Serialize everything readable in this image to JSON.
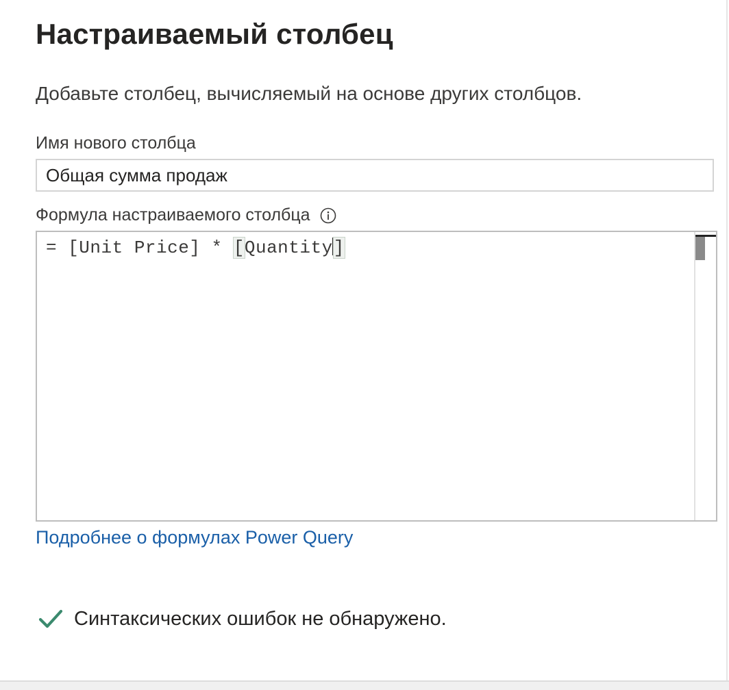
{
  "dialog": {
    "title": "Настраиваемый столбец",
    "subtitle": "Добавьте столбец, вычисляемый на основе других столбцов."
  },
  "name_field": {
    "label": "Имя нового столбца",
    "value": "Общая сумма продаж"
  },
  "formula_field": {
    "label": "Формула настраиваемого столбца",
    "info_icon": "info-icon",
    "prefix": "= [Unit Price] * ",
    "bracket_open": "[",
    "token": "Quantity",
    "bracket_close": "]"
  },
  "learn_link": {
    "label": "Подробнее о формулах Power Query"
  },
  "status": {
    "icon": "checkmark-icon",
    "text": "Синтаксических ошибок не обнаружено."
  },
  "colors": {
    "link": "#1a5fa8",
    "check": "#3b8a6e"
  }
}
